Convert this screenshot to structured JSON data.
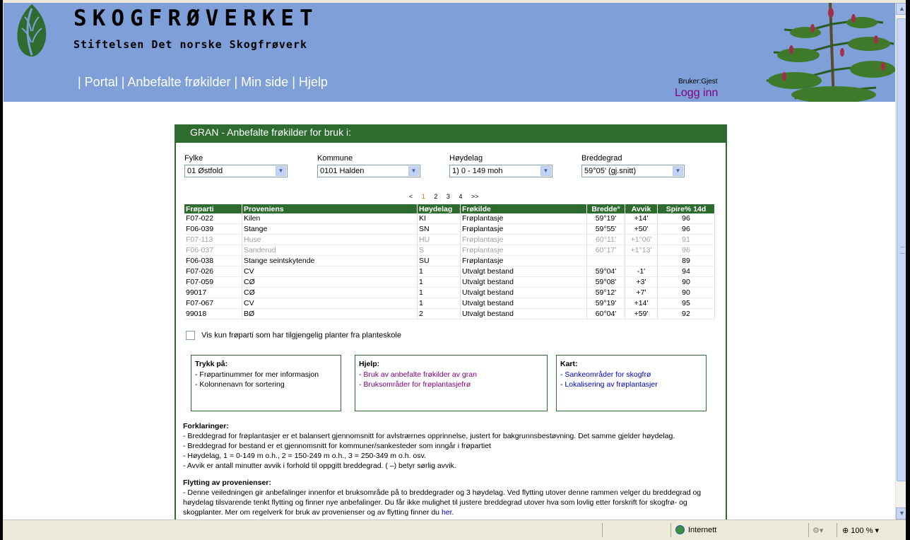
{
  "header": {
    "brand": "SKOGFRØVERKET",
    "subtitle": "Stiftelsen Det norske Skogfrøverk",
    "nav": [
      "| Portal",
      "| Anbefalte frøkilder",
      "| Min side",
      "| Hjelp"
    ],
    "user_label": "Bruker:Gjest",
    "login_label": "Logg inn"
  },
  "panel": {
    "title": "GRAN - Anbefalte frøkilder for bruk i:",
    "selects": [
      {
        "label": "Fylke",
        "value": "01 Østfold"
      },
      {
        "label": "Kommune",
        "value": "0101 Halden"
      },
      {
        "label": "Høydelag",
        "value": "1) 0 - 149 moh"
      },
      {
        "label": "Breddegrad",
        "value": "59°05' (gj.snitt)"
      }
    ],
    "pager": {
      "prev": "<",
      "pages": [
        "1",
        "2",
        "3",
        "4"
      ],
      "current": "1",
      "next": ">>"
    },
    "columns": [
      "Frøparti",
      "Proveniens",
      "Høydelag",
      "Frøkilde",
      "Bredde°",
      "Avvik",
      "Spire% 14d"
    ],
    "rows": [
      {
        "parti": "F07-022",
        "proveniens": "Kilen",
        "hoydelag": "KI",
        "frokilde": "Frøplantasje",
        "bredde": "59°19'",
        "avvik": "+14'",
        "spire": "96",
        "grey": false
      },
      {
        "parti": "F06-039",
        "proveniens": "Stange",
        "hoydelag": "SN",
        "frokilde": "Frøplantasje",
        "bredde": "59°55'",
        "avvik": "+50'",
        "spire": "96",
        "grey": false
      },
      {
        "parti": "F07-113",
        "proveniens": "Huse",
        "hoydelag": "HU",
        "frokilde": "Frøplantasje",
        "bredde": "60°11'",
        "avvik": "+1°06'",
        "spire": "91",
        "grey": true
      },
      {
        "parti": "F06-037",
        "proveniens": "Sanderud",
        "hoydelag": "S",
        "frokilde": "Frøplantasje",
        "bredde": "60°17'",
        "avvik": "+1°13'",
        "spire": "96",
        "grey": true
      },
      {
        "parti": "F06-038",
        "proveniens": "Stange seintskytende",
        "hoydelag": "SU",
        "frokilde": "Frøplantasje",
        "bredde": "",
        "avvik": "",
        "spire": "89",
        "grey": false
      },
      {
        "parti": "F07-026",
        "proveniens": "CV",
        "hoydelag": "1",
        "frokilde": "Utvalgt bestand",
        "bredde": "59°04'",
        "avvik": "-1'",
        "spire": "94",
        "grey": false
      },
      {
        "parti": "F07-059",
        "proveniens": "CØ",
        "hoydelag": "1",
        "frokilde": "Utvalgt bestand",
        "bredde": "59°08'",
        "avvik": "+3'",
        "spire": "90",
        "grey": false
      },
      {
        "parti": "99017",
        "proveniens": "CØ",
        "hoydelag": "1",
        "frokilde": "Utvalgt bestand",
        "bredde": "59°12'",
        "avvik": "+7'",
        "spire": "90",
        "grey": false
      },
      {
        "parti": "F07-067",
        "proveniens": "CV",
        "hoydelag": "1",
        "frokilde": "Utvalgt bestand",
        "bredde": "59°19'",
        "avvik": "+14'",
        "spire": "95",
        "grey": false
      },
      {
        "parti": "99018",
        "proveniens": "BØ",
        "hoydelag": "2",
        "frokilde": "Utvalgt bestand",
        "bredde": "60°04'",
        "avvik": "+59'",
        "spire": "92",
        "grey": false
      }
    ],
    "checkbox_label": "Vis kun frøparti som har tilgjengelig planter fra planteskole",
    "boxes": {
      "trykk": {
        "title": "Trykk på:",
        "lines": [
          "- Frøpartinummer for mer informasjon",
          "- Kolonnenavn for sortering"
        ]
      },
      "hjelp": {
        "title": "Hjelp:",
        "lines": [
          "- Bruk av anbefalte frøkilder av gran",
          "- Bruksområder for frøplantasjefrø"
        ]
      },
      "kart": {
        "title": "Kart:",
        "lines": [
          "- Sankeområder for skogfrø",
          "- Lokalisering av frøplantasjer"
        ]
      }
    },
    "forklaringer": {
      "title": "Forklaringer:",
      "lines": [
        "- Breddegrad for frøplantasjer er et balansert gjennomsnitt for avlstrærnes opprinnelse, justert for bakgrunnsbestøvning. Det samme gjelder høydelag.",
        "- Breddegrad for bestand er et gjennomsnitt for kommuner/sankesteder som inngår i frøpartiet",
        "- Høydelag, 1 = 0-149 m o.h., 2 = 150-249 m o.h., 3 = 250-349 m o.h. osv.",
        "- Avvik er antall minutter avvik i forhold til oppgitt breddegrad. ( –) betyr sørlig avvik."
      ]
    },
    "flytting": {
      "title": "Flytting av provenienser:",
      "text": "- Denne veiledningen gir anbefalinger innenfor et bruksområde på to breddegrader og 3 høydelag. Ved flytting utover denne rammen velger du breddegrad og høydelag tilsvarende tenkt flytting og finner nye anbefalinger. Du får ikke mulighet til justere breddegrad utover hva som lovlig etter forskrift for skogfrø- og skogplanter. Mer om regelverk for bruk av provenienser og av flytting finner du",
      "link": "her",
      "end": "."
    }
  },
  "statusbar": {
    "zone": "Internett",
    "zoom": "100 %"
  },
  "colors": {
    "header_bg": "#7F9FD9",
    "panel_green": "#2E6B2E",
    "link_purple": "#800080",
    "link_blue": "#0000CC"
  }
}
